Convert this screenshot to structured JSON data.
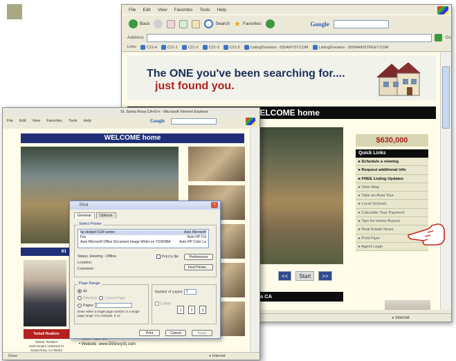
{
  "back_browser": {
    "menu": [
      "File",
      "Edit",
      "View",
      "Favorites",
      "Tools",
      "Help"
    ],
    "toolbar": {
      "back_label": "Back",
      "search_label": "Search",
      "favorites_label": "Favorites",
      "google_label": "Google"
    },
    "address_label": "Address",
    "go_label": "Go",
    "links_label": "Links",
    "links": [
      "C21-4",
      "C21-1",
      "C21-2",
      "C21-3",
      "C21-5",
      "ListingDomains - 555ANYST.COM",
      "ListingDomains - 555MAINSTREET.COM"
    ],
    "page": {
      "tagline_line1": "The ONE you've been searching for....",
      "tagline_line2": "just found you.",
      "welcome": "WELCOME home",
      "price": "$630,000",
      "quick_links_title": "Quick Links",
      "quick_links": [
        {
          "label": "Schedule a viewing",
          "bold": true
        },
        {
          "label": "Request additional info",
          "bold": true
        },
        {
          "label": "FREE Listing Updates",
          "bold": true
        },
        {
          "label": "View Map",
          "bold": false
        },
        {
          "label": "Take an Area Tour",
          "bold": false
        },
        {
          "label": "Local Schools",
          "bold": false
        },
        {
          "label": "Calculate Your Payment",
          "bold": false
        },
        {
          "label": "Tips for Home Buyers",
          "bold": false
        },
        {
          "label": "Real Estate News",
          "bold": false
        },
        {
          "label": "Print Flyer",
          "bold": false
        },
        {
          "label": "Agent Login",
          "bold": false
        }
      ],
      "photo_prev": "<<",
      "photo_start": "Start",
      "photo_next": ">>",
      "city_fragment": "a CA"
    },
    "status_internet": "Internet"
  },
  "front_browser": {
    "title": "St. Santa Rosa CA<t/>r - Microsoft Internet Explorer",
    "menu": [
      "File",
      "Edit",
      "View",
      "Favorites",
      "Tools",
      "Help"
    ],
    "google_label": "Google",
    "page": {
      "welcome": "WELCOME home",
      "nav_fragment": "61",
      "broker_logo": "Tarbell Realtors",
      "broker_name": "Tarbell, Realtors",
      "broker_addr1": "1625 Empire Industrial Ct",
      "broker_addr2": "Santa Rosa, CA 95404",
      "mls_line": "MLS# 123456",
      "website_line": "Website: www.555AnySt.com"
    },
    "status_done": "Done",
    "status_internet": "Internet"
  },
  "print_dialog": {
    "title": "Print",
    "tabs": [
      "General",
      "Options"
    ],
    "select_printer_label": "Select Printer",
    "printers": [
      {
        "left": "hp deskjet 5100 series",
        "right": "Auto Microsoft",
        "selected": true
      },
      {
        "left": "Fax",
        "right": "Auto HP Col",
        "selected": false
      },
      {
        "left": "Auto Microsoft Office Document Image Writer on TOSHIBA",
        "right": "Auto HP Color La",
        "selected": false
      }
    ],
    "status_label": "Status:",
    "status_value": "Deleting - Offline",
    "location_label": "Location:",
    "comment_label": "Comment:",
    "print_to_file": "Print to file",
    "preferences_button": "Preferences",
    "find_printer_button": "Find Printer...",
    "page_range_label": "Page Range",
    "all_label": "All",
    "selection_label": "Selection",
    "current_page_label": "Current Page",
    "pages_label": "Pages:",
    "pages_value": "1",
    "pages_hint": "Enter either a single page number or a single page range. For example, 5-12",
    "copies_label": "Number of copies:",
    "copies_value": "1",
    "collate_label": "Collate",
    "print_button": "Print",
    "cancel_button": "Cancel",
    "apply_button": "Apply"
  }
}
